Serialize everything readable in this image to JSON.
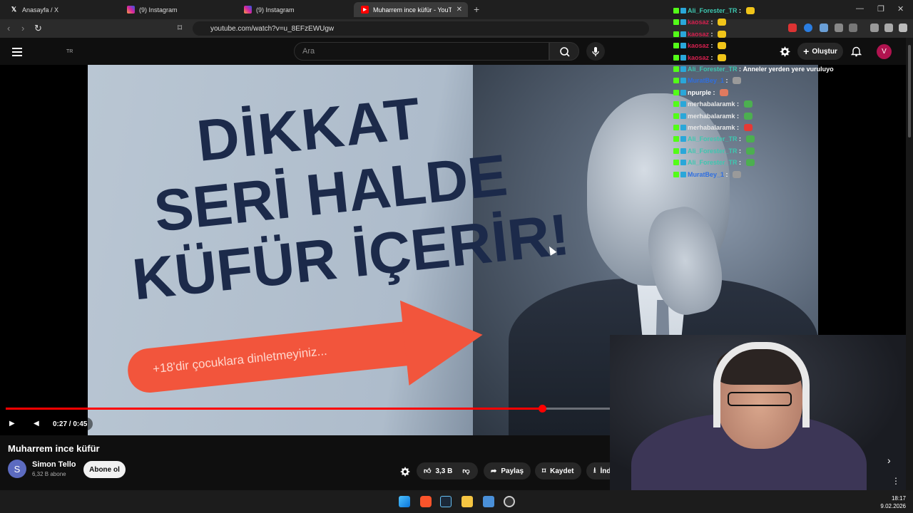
{
  "browser": {
    "tabs": [
      {
        "label": "Anasayfa / X",
        "icon": "x-logo-icon"
      },
      {
        "label": "(9) Instagram",
        "icon": "instagram-icon"
      },
      {
        "label": "(9) Instagram",
        "icon": "instagram-icon"
      },
      {
        "label": "Muharrem ince küfür - YouTube",
        "icon": "youtube-icon",
        "active": true
      }
    ],
    "url": "youtube.com/watch?v=u_8EFzEWUgw"
  },
  "youtube": {
    "country": "TR",
    "search_placeholder": "Ara",
    "create_label": "Oluştur",
    "user_initial": "V",
    "video": {
      "headline_line1": "DİKKAT",
      "headline_line2": "SERİ HALDE",
      "headline_line3": "KÜFÜR İÇERİR!",
      "arrow_text": "+18'dir çocuklara dinletmeyiniz...",
      "time": "0:27 / 0:45",
      "progress": 0.6
    },
    "title": "Muharrem ince küfür",
    "channel": {
      "initial": "S",
      "name": "Simon Tello",
      "subs": "6,32 B abone"
    },
    "subscribe_label": "Abone ol",
    "likes": "3,3 B",
    "share_label": "Paylaş",
    "save_label": "Kaydet",
    "download_label": "İndir"
  },
  "chat": [
    {
      "user": "Ali_Forester_TR",
      "color": "#3ec7b0",
      "text": ""
    },
    {
      "user": "kaosaz",
      "color": "#d6204f",
      "text": ""
    },
    {
      "user": "kaosaz",
      "color": "#d6204f",
      "text": ""
    },
    {
      "user": "kaosaz",
      "color": "#d6204f",
      "text": ""
    },
    {
      "user": "kaosaz",
      "color": "#d6204f",
      "text": ""
    },
    {
      "user": "Ali_Forester_TR",
      "color": "#3ec7b0",
      "text": "Anneler yerden yere vuruluyo"
    },
    {
      "user": "MuratBey_1",
      "color": "#2f6fe0",
      "text": ""
    },
    {
      "user": "npurple",
      "color": "#ffffff",
      "text": ""
    },
    {
      "user": "merhabalaramk",
      "color": "#e8e8e8",
      "text": ""
    },
    {
      "user": "merhabalaramk",
      "color": "#e8e8e8",
      "text": ""
    },
    {
      "user": "merhabalaramk",
      "color": "#e8e8e8",
      "text": ""
    },
    {
      "user": "Ali_Forester_TR",
      "color": "#3ec7b0",
      "text": ""
    },
    {
      "user": "Ali_Forester_TR",
      "color": "#3ec7b0",
      "text": ""
    },
    {
      "user": "Ali_Forester_TR",
      "color": "#3ec7b0",
      "text": ""
    },
    {
      "user": "MuratBey_1",
      "color": "#2f6fe0",
      "text": ""
    }
  ],
  "taskbar": {
    "time": "18:17",
    "date": "9.02.2026"
  }
}
